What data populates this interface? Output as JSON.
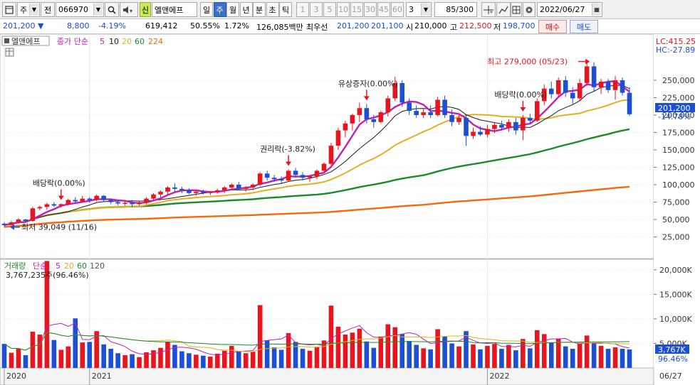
{
  "toolbar": {
    "period_select": "주",
    "prev_label": "전",
    "stock_code": "066970",
    "sin_badge": "신",
    "stock_name": "엘앤에프",
    "period_tabs": [
      "일",
      "주",
      "월",
      "년",
      "분",
      "초",
      "틱"
    ],
    "active_tab": "주",
    "interval_buttons": [
      "1",
      "3",
      "5",
      "10",
      "15",
      "30",
      "45",
      "60"
    ],
    "custom_interval": "3",
    "page_counter": "85/300",
    "date": "2022/06/27"
  },
  "quote": {
    "price": "201,200",
    "change": "8,800",
    "change_pct": "-4.19%",
    "volume": "619,412",
    "volume_ratio": "50.55%",
    "turnover": "1.72%",
    "amount": "126,085백만",
    "best_ask_label": "최우선",
    "best_ask": "201,200",
    "best_bid": "201,100",
    "open_label": "시",
    "open": "210,000",
    "high_label": "고",
    "high": "212,500",
    "low_label": "저",
    "low": "198,700",
    "buy_button": "매수",
    "sell_button": "매도"
  },
  "price_panel": {
    "title": "엘앤에프",
    "ma_label": "종가 단순",
    "ma_periods": [
      "5",
      "10",
      "20",
      "60",
      "224"
    ],
    "lc_label": "LC:415.25",
    "hc_label": "HC:-27.89",
    "current_price_tag": "201,200",
    "current_pct_tag": "-14.78%",
    "y_ticks": [
      "250,000",
      "225,000",
      "200,000",
      "175,000",
      "150,000",
      "125,000",
      "100,000",
      "75,000",
      "50,000",
      "25,000"
    ],
    "annotations": {
      "dividend_2020": "배당락(0.00%)",
      "rights_2021": "권리락(-3.82%)",
      "capital_increase": "유상증자(0.00%)",
      "dividend_2021": "배당락(0.00%)",
      "highest": "최고 279,000 (05/23)",
      "lowest": "최저 39,049 (11/16)"
    }
  },
  "volume_panel": {
    "title": "거래량",
    "ma_label": "단순",
    "ma_periods": [
      "5",
      "20",
      "60",
      "120"
    ],
    "last_volume": "3,767,235주(96.46%)",
    "y_ticks": [
      "20,000K",
      "15,000K",
      "10,000K",
      "5,000K"
    ],
    "current_tag": "3,767K",
    "current_pct_tag": "96.46%"
  },
  "x_axis": {
    "labels": [
      "2020",
      "2021",
      "2022"
    ],
    "end_label": "06/27"
  },
  "colors": {
    "up": "#e8141e",
    "down": "#1b4fd6",
    "ma5": "#c21fb8",
    "ma10": "#1a1a1a",
    "ma20": "#e3b020",
    "ma60": "#1c8a2a",
    "ma224": "#f26a10",
    "sin_badge": "#cfe85a"
  },
  "chart_data": {
    "type": "candlestick",
    "unit": "KRW",
    "ylim": [
      0,
      300000
    ],
    "volume_ylim": [
      0,
      22000
    ],
    "candles": [
      [
        44000,
        46000,
        39049,
        42000,
        4900
      ],
      [
        42000,
        48000,
        41000,
        46000,
        3100
      ],
      [
        46000,
        52000,
        44000,
        50000,
        3900
      ],
      [
        50000,
        51000,
        46000,
        48000,
        2600
      ],
      [
        48000,
        68000,
        47000,
        66000,
        7400
      ],
      [
        66000,
        70000,
        63000,
        68000,
        6800
      ],
      [
        68000,
        74000,
        64000,
        72000,
        21800
      ],
      [
        72000,
        75000,
        68000,
        70000,
        5700
      ],
      [
        70000,
        73000,
        67000,
        72000,
        3700
      ],
      [
        72000,
        80000,
        70000,
        78000,
        4400
      ],
      [
        78000,
        82000,
        74000,
        76000,
        10100
      ],
      [
        76000,
        84000,
        74000,
        80000,
        5200
      ],
      [
        80000,
        82000,
        74000,
        78000,
        5300
      ],
      [
        78000,
        86000,
        76000,
        84000,
        7500
      ],
      [
        84000,
        85000,
        76000,
        78000,
        4800
      ],
      [
        78000,
        80000,
        72000,
        75000,
        3900
      ],
      [
        75000,
        78000,
        70000,
        73000,
        3000
      ],
      [
        73000,
        77000,
        70000,
        74000,
        2600
      ],
      [
        74000,
        78000,
        68000,
        72000,
        2800
      ],
      [
        72000,
        76000,
        70000,
        74000,
        2200
      ],
      [
        74000,
        82000,
        72000,
        80000,
        3200
      ],
      [
        80000,
        88000,
        78000,
        86000,
        3600
      ],
      [
        86000,
        92000,
        82000,
        90000,
        4100
      ],
      [
        90000,
        98000,
        86000,
        96000,
        5300
      ],
      [
        96000,
        102000,
        90000,
        94000,
        4700
      ],
      [
        94000,
        97000,
        88000,
        92000,
        3400
      ],
      [
        92000,
        95000,
        86000,
        88000,
        3000
      ],
      [
        88000,
        92000,
        84000,
        90000,
        2700
      ],
      [
        90000,
        93000,
        86000,
        88000,
        2500
      ],
      [
        88000,
        91000,
        85000,
        90000,
        2300
      ],
      [
        90000,
        94000,
        87000,
        92000,
        2900
      ],
      [
        92000,
        98000,
        88000,
        96000,
        3500
      ],
      [
        96000,
        102000,
        92000,
        100000,
        4500
      ],
      [
        100000,
        104000,
        92000,
        94000,
        3400
      ],
      [
        94000,
        98000,
        90000,
        96000,
        3000
      ],
      [
        96000,
        102000,
        92000,
        100000,
        3300
      ],
      [
        100000,
        118000,
        98000,
        116000,
        12800
      ],
      [
        116000,
        120000,
        106000,
        110000,
        5600
      ],
      [
        110000,
        114000,
        104000,
        108000,
        4200
      ],
      [
        108000,
        112000,
        102000,
        106000,
        3700
      ],
      [
        106000,
        122000,
        104000,
        120000,
        7100
      ],
      [
        120000,
        124000,
        110000,
        114000,
        5300
      ],
      [
        114000,
        118000,
        106000,
        110000,
        3900
      ],
      [
        110000,
        114000,
        104000,
        112000,
        3500
      ],
      [
        112000,
        122000,
        108000,
        120000,
        4300
      ],
      [
        120000,
        132000,
        118000,
        130000,
        5600
      ],
      [
        130000,
        160000,
        128000,
        156000,
        12700
      ],
      [
        156000,
        182000,
        150000,
        178000,
        8400
      ],
      [
        178000,
        192000,
        168000,
        188000,
        6800
      ],
      [
        188000,
        202000,
        178000,
        200000,
        7200
      ],
      [
        200000,
        218000,
        190000,
        210000,
        8000
      ],
      [
        210000,
        216000,
        188000,
        194000,
        5400
      ],
      [
        194000,
        200000,
        182000,
        190000,
        4100
      ],
      [
        190000,
        206000,
        188000,
        204000,
        6400
      ],
      [
        204000,
        228000,
        198000,
        224000,
        8900
      ],
      [
        224000,
        255000,
        220000,
        246000,
        8300
      ],
      [
        246000,
        250000,
        212000,
        218000,
        6900
      ],
      [
        218000,
        224000,
        200000,
        206000,
        5500
      ],
      [
        206000,
        214000,
        196000,
        200000,
        4700
      ],
      [
        200000,
        210000,
        196000,
        204000,
        4000
      ],
      [
        204000,
        214000,
        196000,
        200000,
        3800
      ],
      [
        200000,
        226000,
        198000,
        222000,
        7900
      ],
      [
        222000,
        228000,
        196000,
        200000,
        6400
      ],
      [
        200000,
        208000,
        184000,
        190000,
        5000
      ],
      [
        190000,
        200000,
        186000,
        196000,
        4400
      ],
      [
        196000,
        200000,
        156000,
        170000,
        7500
      ],
      [
        170000,
        182000,
        166000,
        176000,
        4800
      ],
      [
        176000,
        184000,
        170000,
        172000,
        3800
      ],
      [
        172000,
        186000,
        168000,
        180000,
        4500
      ],
      [
        180000,
        190000,
        174000,
        186000,
        4900
      ],
      [
        186000,
        192000,
        178000,
        182000,
        3900
      ],
      [
        182000,
        194000,
        176000,
        190000,
        4700
      ],
      [
        190000,
        196000,
        172000,
        178000,
        3600
      ],
      [
        178000,
        200000,
        164000,
        196000,
        5900
      ],
      [
        196000,
        202000,
        188000,
        192000,
        4000
      ],
      [
        192000,
        224000,
        190000,
        220000,
        7700
      ],
      [
        220000,
        244000,
        214000,
        238000,
        6900
      ],
      [
        238000,
        248000,
        224000,
        230000,
        5100
      ],
      [
        230000,
        254000,
        226000,
        250000,
        6000
      ],
      [
        250000,
        256000,
        226000,
        232000,
        4400
      ],
      [
        232000,
        240000,
        216000,
        224000,
        3900
      ],
      [
        224000,
        252000,
        220000,
        246000,
        5000
      ],
      [
        246000,
        279000,
        242000,
        270000,
        6600
      ],
      [
        270000,
        276000,
        234000,
        240000,
        5200
      ],
      [
        240000,
        252000,
        230000,
        248000,
        4500
      ],
      [
        248000,
        252000,
        232000,
        236000,
        3900
      ],
      [
        236000,
        256000,
        222000,
        250000,
        4200
      ],
      [
        250000,
        254000,
        228000,
        232000,
        3900
      ],
      [
        232000,
        240000,
        198700,
        201200,
        3767
      ]
    ]
  }
}
